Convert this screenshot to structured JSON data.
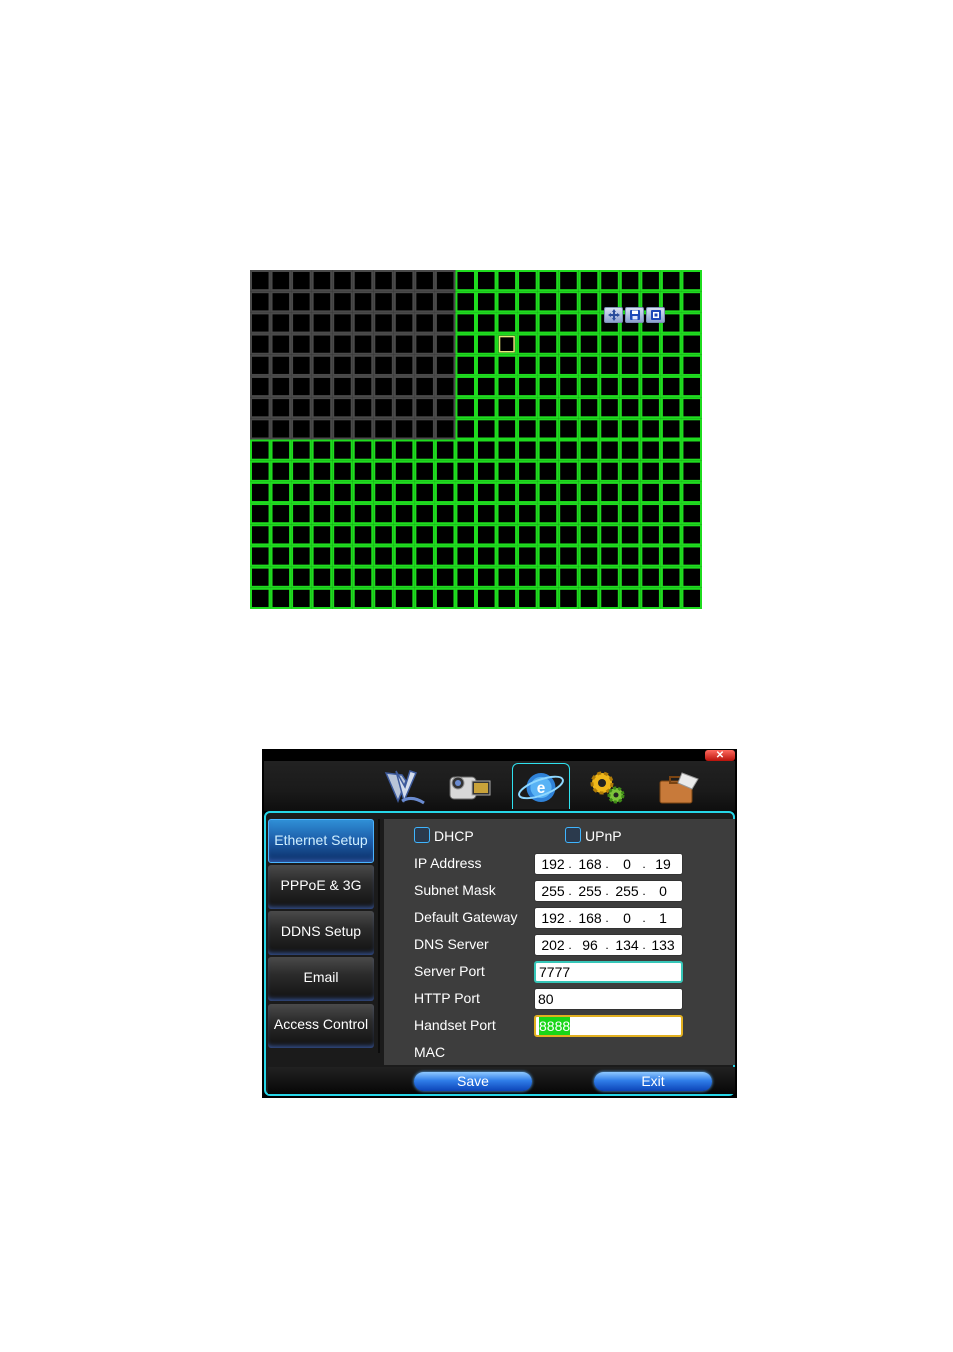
{
  "motion_grid": {
    "cols": 22,
    "rows": 16,
    "inactive_cols": 10,
    "inactive_rows": 8,
    "active_color": "#1fdc1f",
    "inactive_color": "#4a4a4a",
    "cursor_color": "#e8e87a",
    "toolbar": [
      "move-icon",
      "save-icon",
      "exit-icon"
    ]
  },
  "dialog": {
    "close_label": "✕",
    "main_tabs": [
      {
        "name": "record-icon",
        "active": false
      },
      {
        "name": "camera-icon",
        "active": false
      },
      {
        "name": "network-icon",
        "active": true
      },
      {
        "name": "settings-icon",
        "active": false
      },
      {
        "name": "tools-icon",
        "active": false
      }
    ],
    "side_nav": [
      {
        "label": "Ethernet Setup",
        "active": true
      },
      {
        "label": "PPPoE & 3G",
        "active": false
      },
      {
        "label": "DDNS Setup",
        "active": false
      },
      {
        "label": "Email",
        "active": false
      },
      {
        "label": "Access Control",
        "active": false
      }
    ],
    "dhcp_label": "DHCP",
    "upnp_label": "UPnP",
    "fields": {
      "ip_address": {
        "label": "IP Address",
        "octets": [
          "192",
          "168",
          "0",
          "19"
        ]
      },
      "subnet_mask": {
        "label": "Subnet Mask",
        "octets": [
          "255",
          "255",
          "255",
          "0"
        ]
      },
      "default_gateway": {
        "label": "Default Gateway",
        "octets": [
          "192",
          "168",
          "0",
          "1"
        ]
      },
      "dns_server": {
        "label": "DNS Server",
        "octets": [
          "202",
          "96",
          "134",
          "133"
        ]
      },
      "server_port": {
        "label": "Server Port",
        "value": "7777"
      },
      "http_port": {
        "label": "HTTP Port",
        "value": "80"
      },
      "handset_port": {
        "label": "Handset Port",
        "value": "8888"
      },
      "mac": {
        "label": "MAC"
      }
    },
    "save_label": "Save",
    "exit_label": "Exit"
  }
}
